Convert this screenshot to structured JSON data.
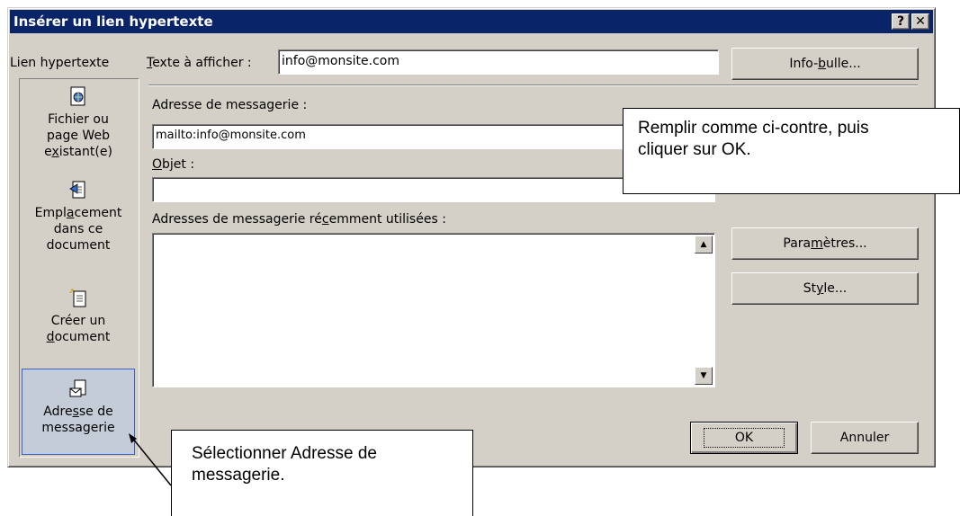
{
  "dialog": {
    "title": "Insérer un lien hypertexte",
    "help_button": "?",
    "close_button": "✕"
  },
  "linkbar": {
    "label": "Lien hypertexte",
    "items": [
      {
        "line1": "Fichier ou",
        "line2": "page Web",
        "line3": "existant(e)",
        "icon": "file-web-icon"
      },
      {
        "line1": "Emplacement",
        "line2": "dans ce",
        "line3": "document",
        "icon": "place-in-document-icon"
      },
      {
        "line1": "Créer un",
        "line2": "document",
        "icon": "new-document-icon"
      },
      {
        "line1": "Adresse de",
        "line2": "messagerie",
        "icon": "email-address-icon",
        "selected": true
      }
    ]
  },
  "form": {
    "display_text_label": "Texte à afficher :",
    "display_text_value": "info@monsite.com",
    "tooltip_button": "Info-bulle...",
    "email_label": "Adresse de messagerie :",
    "email_value": "mailto:info@monsite.com",
    "subject_label": "Objet :",
    "subject_value": "",
    "recent_label": "Adresses de messagerie récemment utilisées :",
    "recent_items": [],
    "params_button": "Paramètres...",
    "style_button": "Style...",
    "ok_button": "OK",
    "cancel_button": "Annuler"
  },
  "callouts": {
    "top_right_line1": "Remplir comme ci-contre, puis",
    "top_right_line2": "cliquer sur OK.",
    "bottom_line1": "Sélectionner Adresse de",
    "bottom_line2": "messagerie."
  },
  "colors": {
    "titlebar": "#0a246a",
    "dialog_face": "#d4d0c8",
    "selected_item": "#c4ccd8"
  }
}
